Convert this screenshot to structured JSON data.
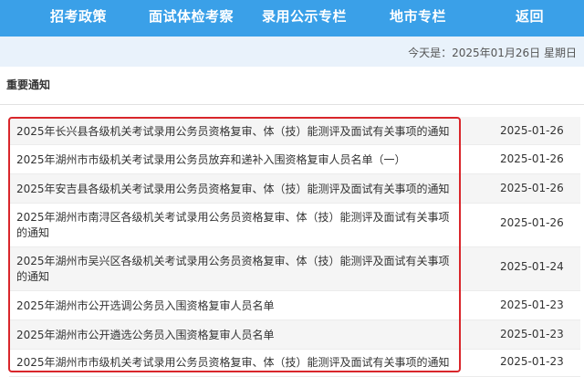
{
  "nav": {
    "items": [
      {
        "label": "招考政策"
      },
      {
        "label": "面试体检考察"
      },
      {
        "label": "录用公示专栏"
      },
      {
        "label": "地市专栏"
      },
      {
        "label": "返回"
      }
    ]
  },
  "date_bar": {
    "text": "今天是：2025年01月26日 星期日"
  },
  "section": {
    "title": "重要通知"
  },
  "notices": [
    {
      "title": "2025年长兴县各级机关考试录用公务员资格复审、体（技）能测评及面试有关事项的通知",
      "date": "2025-01-26"
    },
    {
      "title": "2025年湖州市市级机关考试录用公务员放弃和递补入围资格复审人员名单（一）",
      "date": "2025-01-26"
    },
    {
      "title": "2025年安吉县各级机关考试录用公务员资格复审、体（技）能测评及面试有关事项的通知",
      "date": "2025-01-26"
    },
    {
      "title": "2025年湖州市南浔区各级机关考试录用公务员资格复审、体（技）能测评及面试有关事项的通知",
      "date": "2025-01-26"
    },
    {
      "title": "2025年湖州市吴兴区各级机关考试录用公务员资格复审、体（技）能测评及面试有关事项的通知",
      "date": "2025-01-24"
    },
    {
      "title": "2025年湖州市公开选调公务员入围资格复审人员名单",
      "date": "2025-01-23"
    },
    {
      "title": "2025年湖州市公开遴选公务员入围资格复审人员名单",
      "date": "2025-01-23"
    },
    {
      "title": "2025年湖州市市级机关考试录用公务员资格复审、体（技）能测评及面试有关事项的通知",
      "date": "2025-01-23"
    }
  ],
  "colors": {
    "nav_bg": "#3aa0e8",
    "date_bar_bg": "#e9f2fb",
    "highlight_border": "#d9262b"
  }
}
